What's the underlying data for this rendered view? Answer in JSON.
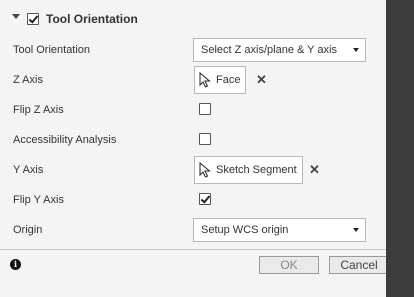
{
  "section": {
    "title": "Tool Orientation",
    "checked": true
  },
  "rows": {
    "tool_orientation": {
      "label": "Tool Orientation",
      "value": "Select Z axis/plane & Y axis"
    },
    "z_axis": {
      "label": "Z Axis",
      "value": "Face"
    },
    "flip_z": {
      "label": "Flip Z Axis",
      "checked": false
    },
    "accessibility": {
      "label": "Accessibility Analysis",
      "checked": false
    },
    "y_axis": {
      "label": "Y Axis",
      "value": "Sketch Segment"
    },
    "flip_y": {
      "label": "Flip Y Axis",
      "checked": true
    },
    "origin": {
      "label": "Origin",
      "value": "Setup WCS origin"
    }
  },
  "footer": {
    "ok_label": "OK",
    "cancel_label": "Cancel",
    "info_icon": "i"
  },
  "icons": {
    "cursor": "cursor-arrow-icon",
    "clear": "x-icon",
    "info": "info-icon"
  }
}
